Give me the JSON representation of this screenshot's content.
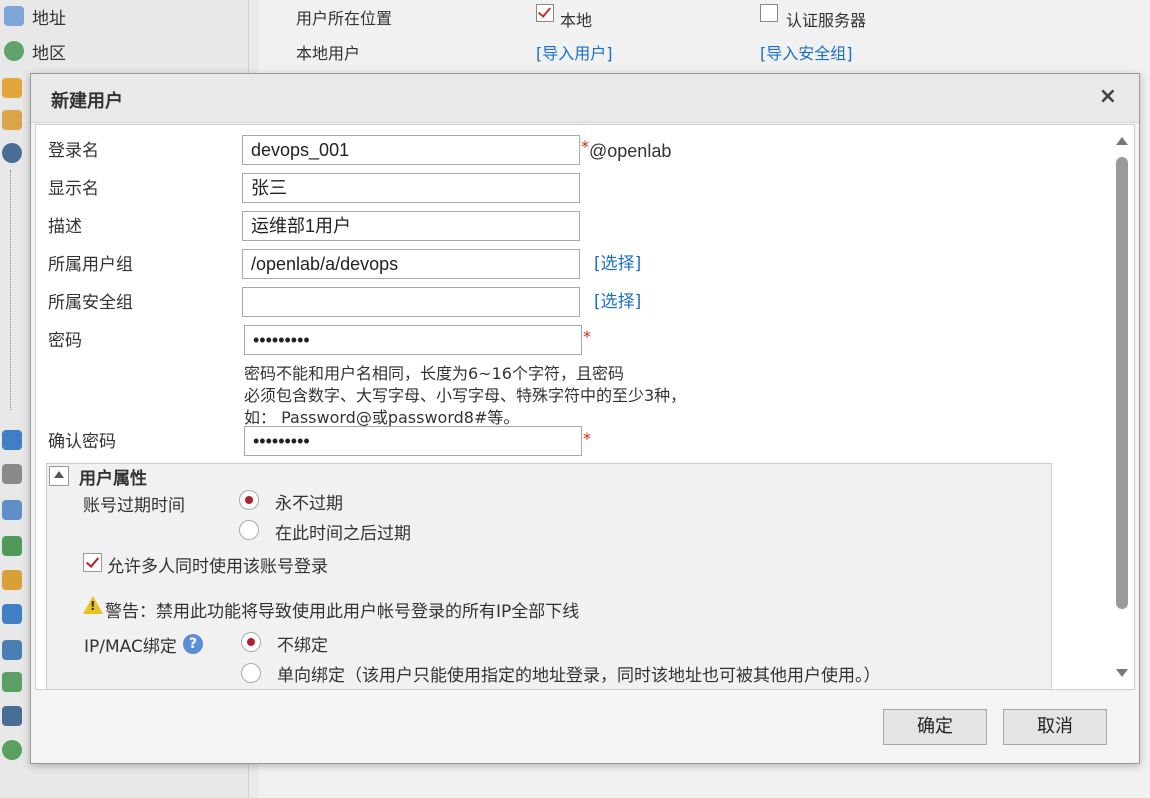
{
  "background": {
    "sidebar_items": [
      "地址",
      "地区"
    ],
    "location_label": "用户所在位置",
    "local_label": "本地",
    "auth_server_label": "认证服务器",
    "local_user_label": "本地用户",
    "import_users_link": "[导入用户]",
    "import_security_link": "[导入安全组]"
  },
  "dialog": {
    "title": "新建用户",
    "close_icon": "×",
    "fields": {
      "login_name": {
        "label": "登录名",
        "value": "devops_001",
        "suffix": "@openlab",
        "required": "*"
      },
      "display_name": {
        "label": "显示名",
        "value": "张三"
      },
      "description": {
        "label": "描述",
        "value": "运维部1用户"
      },
      "user_group": {
        "label": "所属用户组",
        "value": "/openlab/a/devops",
        "select_link": "[选择]"
      },
      "security_group": {
        "label": "所属安全组",
        "value": "",
        "select_link": "[选择]"
      },
      "password": {
        "label": "密码",
        "value": "•••••••••",
        "required": "*"
      },
      "confirm_password": {
        "label": "确认密码",
        "value": "•••••••••",
        "required": "*"
      }
    },
    "password_hint": [
      "密码不能和用户名相同，长度为6~16个字符，且密码",
      "必须包含数字、大写字母、小写字母、特殊字符中的至少3种，",
      "如： Password@或password8#等。"
    ],
    "user_attributes": {
      "title": "用户属性",
      "expiry_label": "账号过期时间",
      "never_expire": "永不过期",
      "expire_after": "在此时间之后过期",
      "multi_login": "允许多人同时使用该账号登录",
      "warning": "警告：禁用此功能将导致使用此用户帐号登录的所有IP全部下线",
      "ipmac_label": "IP/MAC绑定",
      "help_icon": "?",
      "no_bind": "不绑定",
      "one_way_bind": "单向绑定（该用户只能使用指定的地址登录，同时该地址也可被其他用户使用。）"
    },
    "ok_button": "确定",
    "cancel_button": "取消"
  },
  "colors": {
    "accent_radio": "#b0222b",
    "link": "#1a6fc7",
    "required": "#dd2211"
  }
}
